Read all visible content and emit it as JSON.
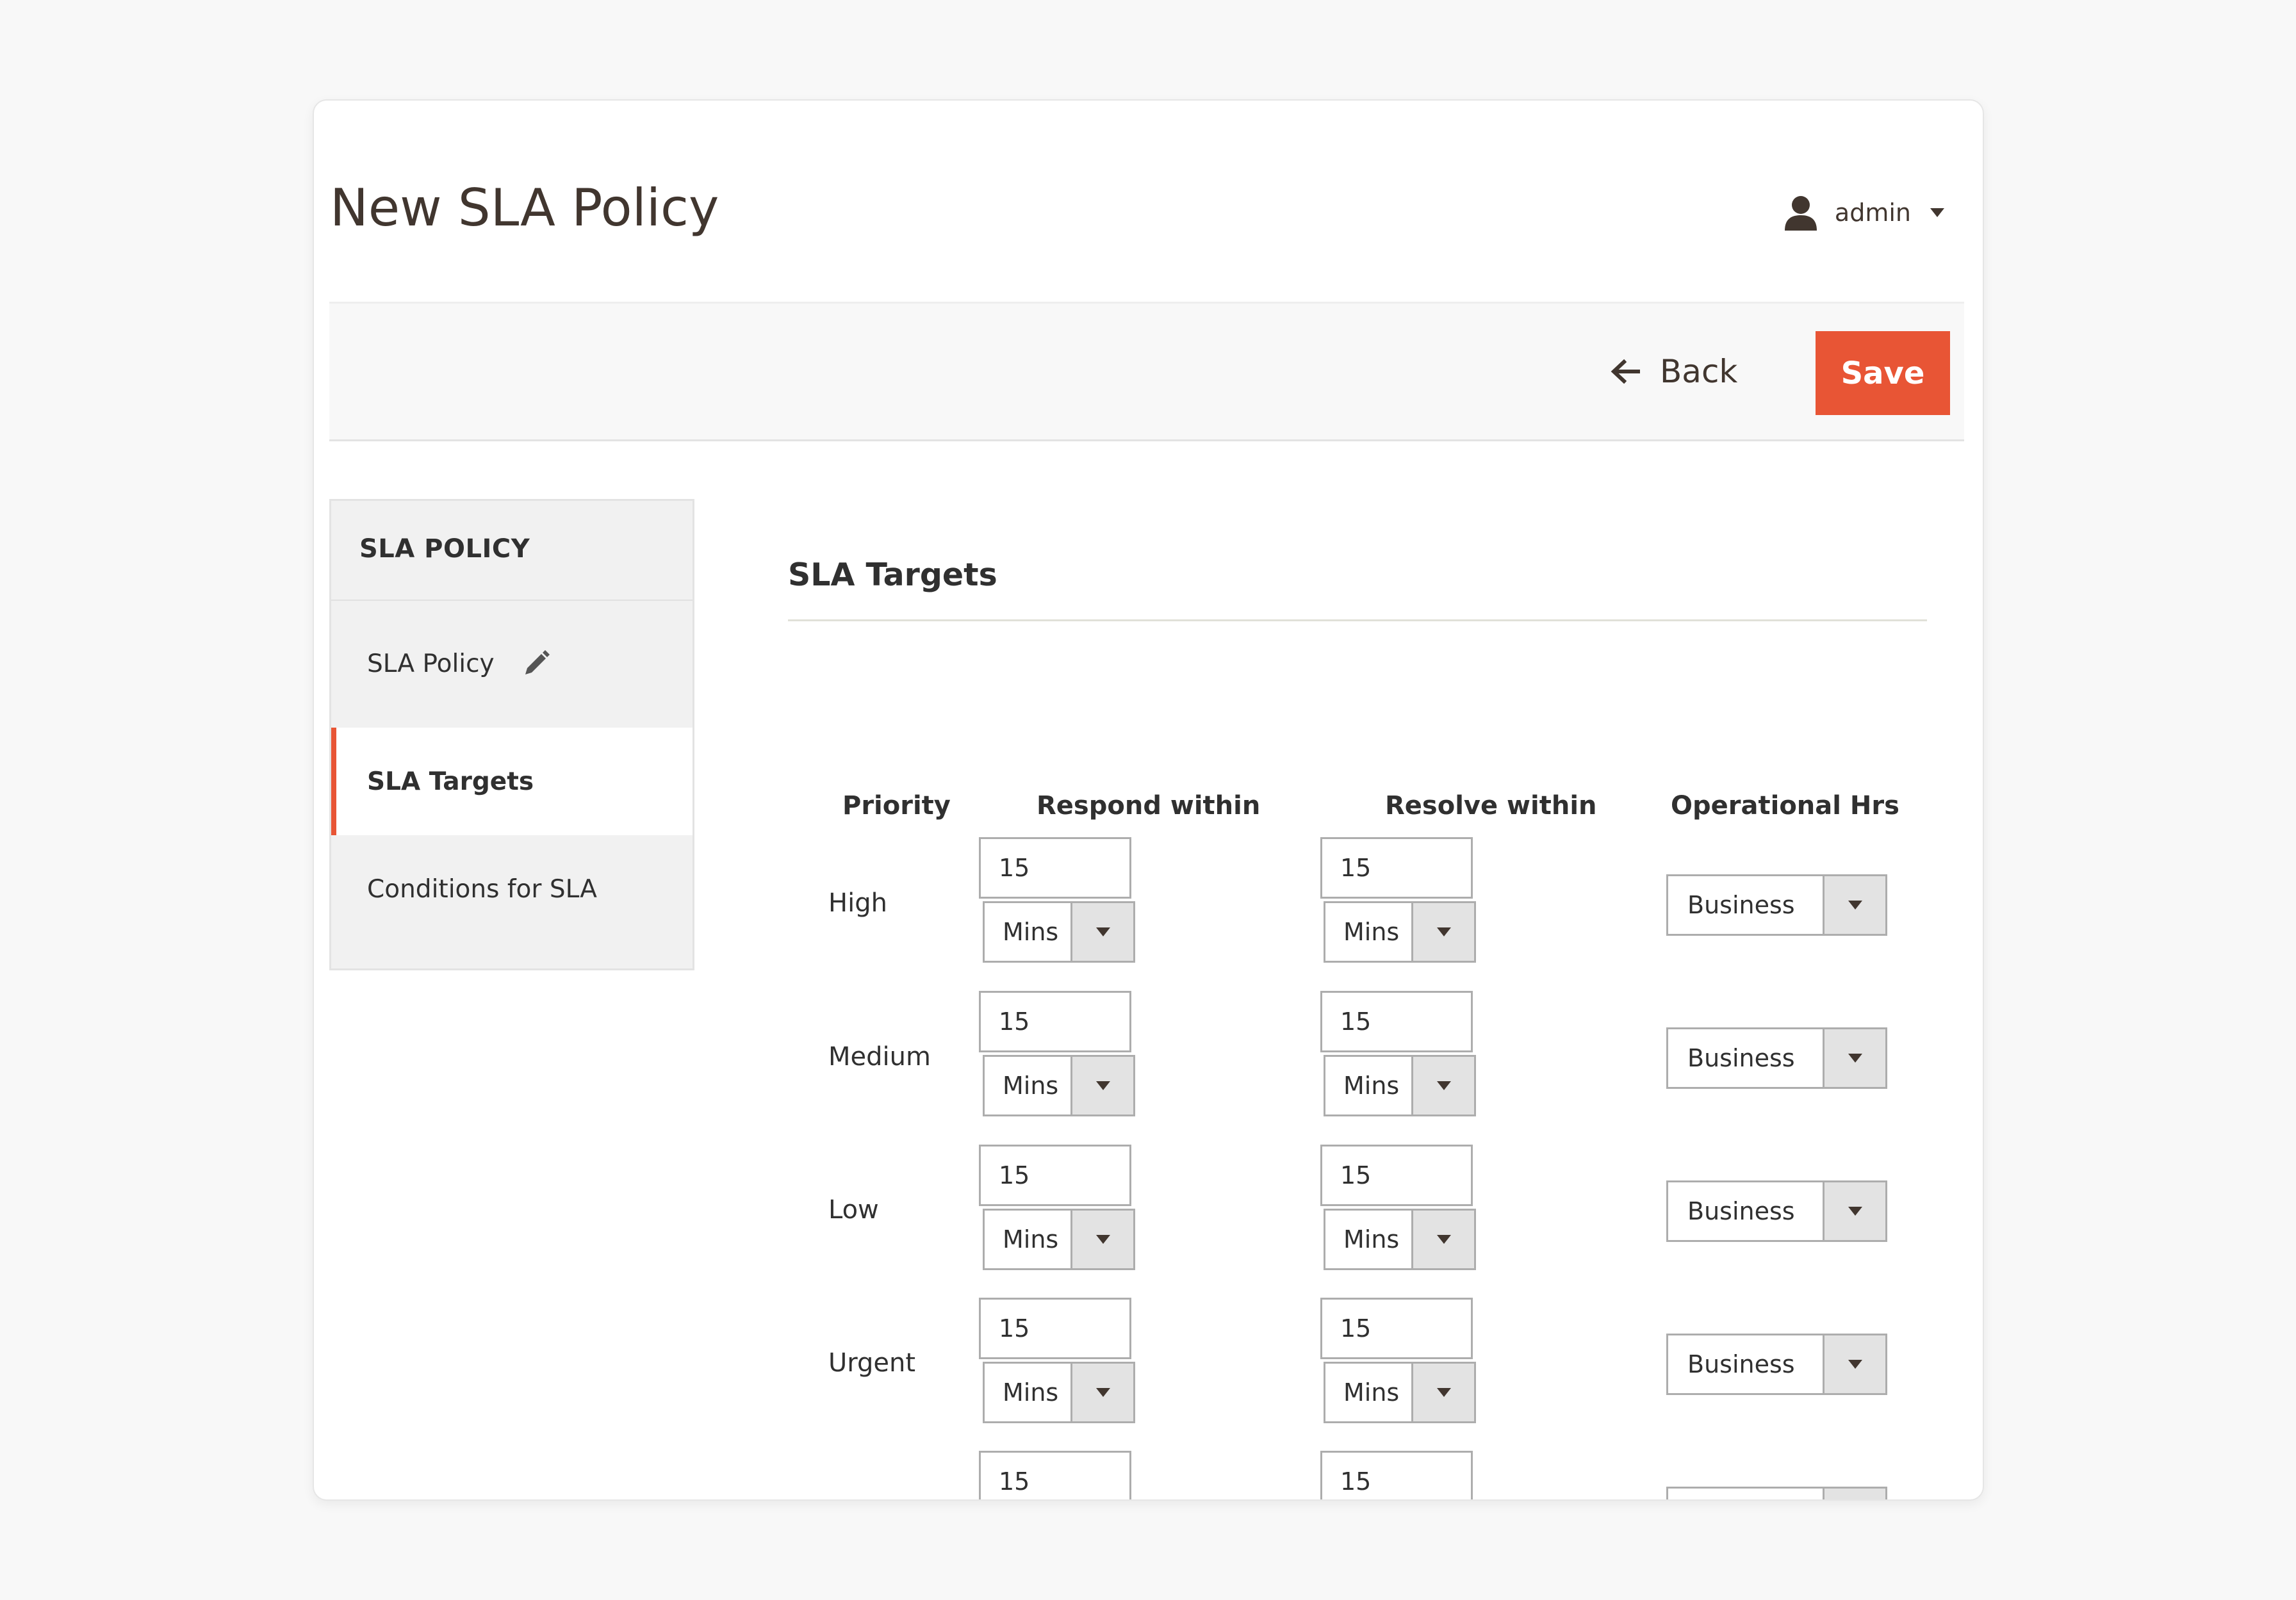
{
  "page": {
    "title": "New SLA Policy"
  },
  "user": {
    "name": "admin",
    "icon": "user-icon"
  },
  "actions": {
    "back_label": "Back",
    "save_label": "Save",
    "save_color": "#e85535"
  },
  "sidebar": {
    "title": "SLA POLICY",
    "items": [
      {
        "label": "SLA Policy",
        "icon": "pencil-icon"
      },
      {
        "label": "SLA Targets",
        "active": true
      },
      {
        "label": "Conditions for SLA"
      }
    ]
  },
  "section": {
    "title": "SLA Targets"
  },
  "table": {
    "headers": [
      "Priority",
      "Respond within",
      "Resolve within",
      "Operational Hrs"
    ],
    "rows": [
      {
        "priority": "High",
        "respond_value": "15",
        "respond_unit": "Mins",
        "resolve_value": "15",
        "resolve_unit": "Mins",
        "hours": "Business"
      },
      {
        "priority": "Medium",
        "respond_value": "15",
        "respond_unit": "Mins",
        "resolve_value": "15",
        "resolve_unit": "Mins",
        "hours": "Business"
      },
      {
        "priority": "Low",
        "respond_value": "15",
        "respond_unit": "Mins",
        "resolve_value": "15",
        "resolve_unit": "Mins",
        "hours": "Business"
      },
      {
        "priority": "Urgent",
        "respond_value": "15",
        "respond_unit": "Mins",
        "resolve_value": "15",
        "resolve_unit": "Mins",
        "hours": "Business"
      },
      {
        "priority": "",
        "respond_value": "15",
        "respond_unit": "",
        "resolve_value": "15",
        "resolve_unit": "",
        "hours": ""
      }
    ]
  }
}
